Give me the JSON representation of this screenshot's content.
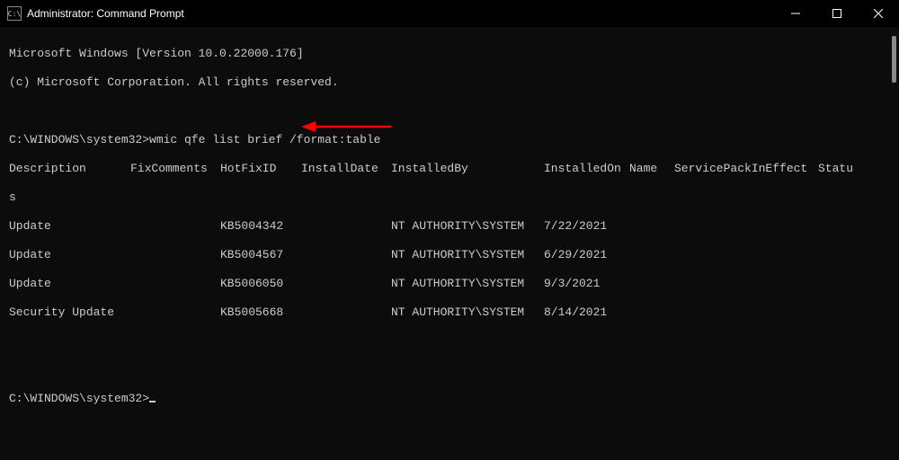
{
  "titlebar": {
    "icon_label": "C:\\",
    "title": "Administrator: Command Prompt"
  },
  "banner": {
    "line1": "Microsoft Windows [Version 10.0.22000.176]",
    "line2": "(c) Microsoft Corporation. All rights reserved."
  },
  "prompt1": {
    "cwd": "C:\\WINDOWS\\system32>",
    "command": "wmic qfe list brief /format:table"
  },
  "headers": {
    "description": "Description",
    "fixcomments": "FixComments",
    "hotfixid": "HotFixID",
    "installdate": "InstallDate",
    "installedby": "InstalledBy",
    "installedon": "InstalledOn",
    "name": "Name",
    "servicepack": "ServicePackInEffect",
    "status": "Statu",
    "status_wrap": "s"
  },
  "rows": [
    {
      "description": "Update",
      "fixcomments": "",
      "hotfixid": "KB5004342",
      "installdate": "",
      "installedby": "NT AUTHORITY\\SYSTEM",
      "installedon": "7/22/2021"
    },
    {
      "description": "Update",
      "fixcomments": "",
      "hotfixid": "KB5004567",
      "installdate": "",
      "installedby": "NT AUTHORITY\\SYSTEM",
      "installedon": "6/29/2021"
    },
    {
      "description": "Update",
      "fixcomments": "",
      "hotfixid": "KB5006050",
      "installdate": "",
      "installedby": "NT AUTHORITY\\SYSTEM",
      "installedon": "9/3/2021"
    },
    {
      "description": "Security Update",
      "fixcomments": "",
      "hotfixid": "KB5005668",
      "installdate": "",
      "installedby": "NT AUTHORITY\\SYSTEM",
      "installedon": "8/14/2021"
    }
  ],
  "prompt2": {
    "cwd": "C:\\WINDOWS\\system32>"
  },
  "annotation": {
    "arrow_color": "#ff0000",
    "points_to_row_index": 1
  }
}
